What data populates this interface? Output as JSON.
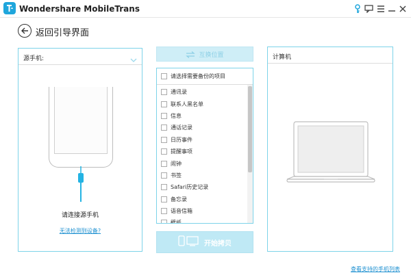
{
  "window": {
    "title": "Wondershare MobileTrans",
    "logo_icon": "mobiletrans-logo-icon",
    "controls": [
      "key-icon",
      "feedback-icon",
      "menu-icon",
      "minimize-icon",
      "close-icon"
    ]
  },
  "header": {
    "back_label": "返回引导界面"
  },
  "source": {
    "title": "源手机:",
    "connect_text": "请连接源手机",
    "detect_link": "无法检测到设备?"
  },
  "transfer": {
    "swap_label": "互换位置",
    "select_all_label": "请选择需要备份的项目",
    "items": [
      {
        "label": "通讯录"
      },
      {
        "label": "联系人黑名单"
      },
      {
        "label": "信息"
      },
      {
        "label": "通话记录"
      },
      {
        "label": "日历事件"
      },
      {
        "label": "提醒事项"
      },
      {
        "label": "闹钟"
      },
      {
        "label": "书签"
      },
      {
        "label": "Safari历史记录"
      },
      {
        "label": "备忘录"
      },
      {
        "label": "语音信箱"
      },
      {
        "label": "壁纸"
      }
    ],
    "start_label": "开始拷贝"
  },
  "target": {
    "title": "计算机"
  },
  "footer": {
    "supported_phones_link": "查看支持的手机列表"
  },
  "colors": {
    "accent": "#1fa6dc",
    "panel_border": "#7cd3e9",
    "disabled_button": "#bfe9f5",
    "link": "#1b8fd0"
  }
}
